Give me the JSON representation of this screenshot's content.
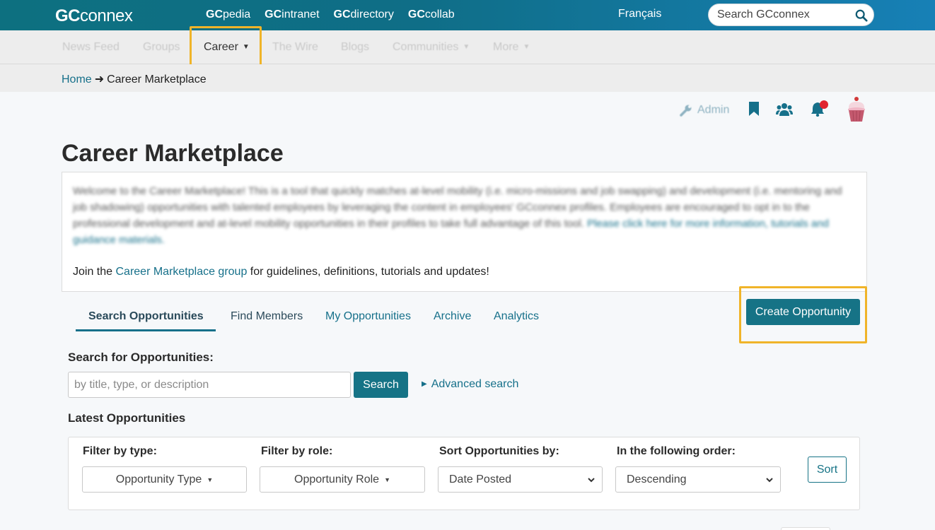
{
  "top": {
    "logo_bold": "GC",
    "logo_rest": "connex",
    "links": [
      {
        "bold": "GC",
        "rest": "pedia"
      },
      {
        "bold": "GC",
        "rest": "intranet"
      },
      {
        "bold": "GC",
        "rest": "directory"
      },
      {
        "bold": "GC",
        "rest": "collab"
      }
    ],
    "language": "Français",
    "search_placeholder": "Search GCconnex"
  },
  "nav": {
    "items": [
      "News Feed",
      "Groups",
      "Career",
      "The Wire",
      "Blogs",
      "Communities",
      "More"
    ],
    "active": "Career"
  },
  "breadcrumb": {
    "home": "Home",
    "arrow": "➜",
    "current": "Career Marketplace"
  },
  "utility": {
    "admin_label": "Admin"
  },
  "page": {
    "title": "Career Marketplace",
    "intro_text": "Welcome to the Career Marketplace! This is a tool that quickly matches at-level mobility (i.e. micro-missions and job swapping) and development (i.e. mentoring and job shadowing) opportunities with talented employees by leveraging the content in employees' GCconnex profiles. Employees are encouraged to opt in to the professional development and at-level mobility opportunities in their profiles to take full advantage of this tool.",
    "intro_link": "Please click here for more information, tutorials and guidance materials.",
    "join_prefix": "Join the ",
    "join_link": "Career Marketplace group",
    "join_suffix": " for guidelines, definitions, tutorials and updates!"
  },
  "tabs": [
    "Search Opportunities",
    "Find Members",
    "My Opportunities",
    "Archive",
    "Analytics"
  ],
  "create_button": "Create Opportunity",
  "search": {
    "label": "Search for Opportunities:",
    "placeholder": "by title, type, or description",
    "button": "Search",
    "advanced": "Advanced search"
  },
  "latest": {
    "heading": "Latest Opportunities",
    "filters": {
      "type_label": "Filter by type:",
      "type_value": "Opportunity Type",
      "role_label": "Filter by role:",
      "role_value": "Opportunity Role",
      "sort_label": "Sort Opportunities by:",
      "sort_value": "Date Posted",
      "order_label": "In the following order:",
      "order_value": "Descending",
      "sort_button": "Sort"
    }
  },
  "colors": {
    "brand": "#167386",
    "highlight": "#f0b429",
    "notification": "#e0242f"
  }
}
